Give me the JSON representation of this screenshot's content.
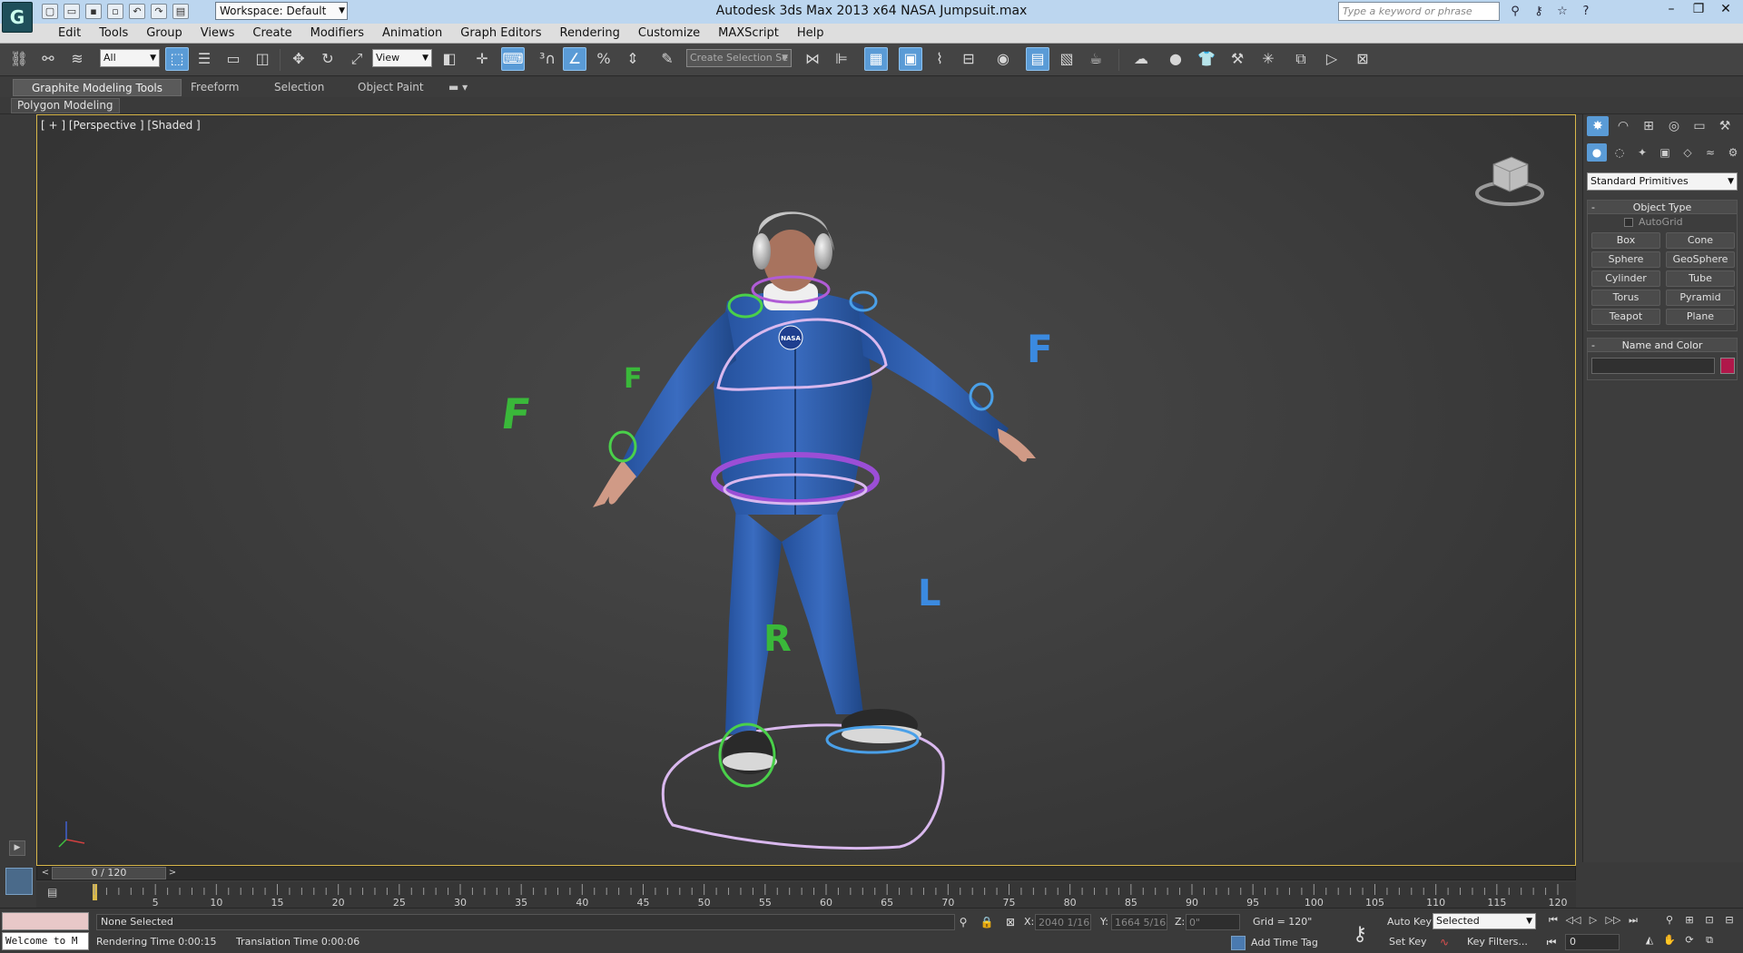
{
  "titlebar": {
    "workspace_label": "Workspace: Default",
    "title": "Autodesk 3ds Max  2013 x64      NASA Jumpsuit.max",
    "search_placeholder": "Type a keyword or phrase",
    "icons": [
      "binoculars-icon",
      "key-icon",
      "star-icon",
      "help-icon"
    ]
  },
  "menu": {
    "items": [
      "Edit",
      "Tools",
      "Group",
      "Views",
      "Create",
      "Modifiers",
      "Animation",
      "Graph Editors",
      "Rendering",
      "Customize",
      "MAXScript",
      "Help"
    ]
  },
  "toolbar": {
    "selection_filter": "All",
    "ref_coord": "View",
    "selection_set_placeholder": "Create Selection Se"
  },
  "ribbon": {
    "tabs": [
      "Graphite Modeling Tools",
      "Freeform",
      "Selection",
      "Object Paint"
    ],
    "panel_label": "Polygon Modeling"
  },
  "viewport": {
    "label": "[ + ] [Perspective ] [Shaded ]",
    "emblem": "NASA",
    "helper_letters": {
      "f1": "F",
      "f2": "F",
      "f3": "F",
      "r": "R",
      "l": "L"
    }
  },
  "command_panel": {
    "category": "Standard Primitives",
    "object_type_title": "Object Type",
    "autogrid_label": "AutoGrid",
    "primitives": [
      "Box",
      "Cone",
      "Sphere",
      "GeoSphere",
      "Cylinder",
      "Tube",
      "Torus",
      "Pyramid",
      "Teapot",
      "Plane"
    ],
    "name_color_title": "Name and Color",
    "swatch_color": "#b0174a"
  },
  "timeline": {
    "slider_label": "0 / 120",
    "ticks": [
      "0",
      "5",
      "10",
      "15",
      "20",
      "25",
      "30",
      "35",
      "40",
      "45",
      "50",
      "55",
      "60",
      "65",
      "70",
      "75",
      "80",
      "85",
      "90",
      "95",
      "100",
      "105",
      "110",
      "115",
      "120"
    ]
  },
  "status": {
    "maxscript_text": "Welcome to M",
    "selection_status": "None Selected",
    "rendering_time_label": "Rendering Time  0:00:15",
    "translation_time_label": "Translation Time  0:00:06",
    "x_label": "X:",
    "x_value": "2040 1/16\"",
    "y_label": "Y:",
    "y_value": "1664 5/16\"",
    "z_label": "Z:",
    "z_value": "0\"",
    "grid_label": "Grid = 120\"",
    "add_time_tag": "Add Time Tag",
    "auto_key": "Auto Key",
    "set_key": "Set Key",
    "key_mode": "Selected",
    "key_filters": "Key Filters...",
    "current_frame": "0"
  }
}
